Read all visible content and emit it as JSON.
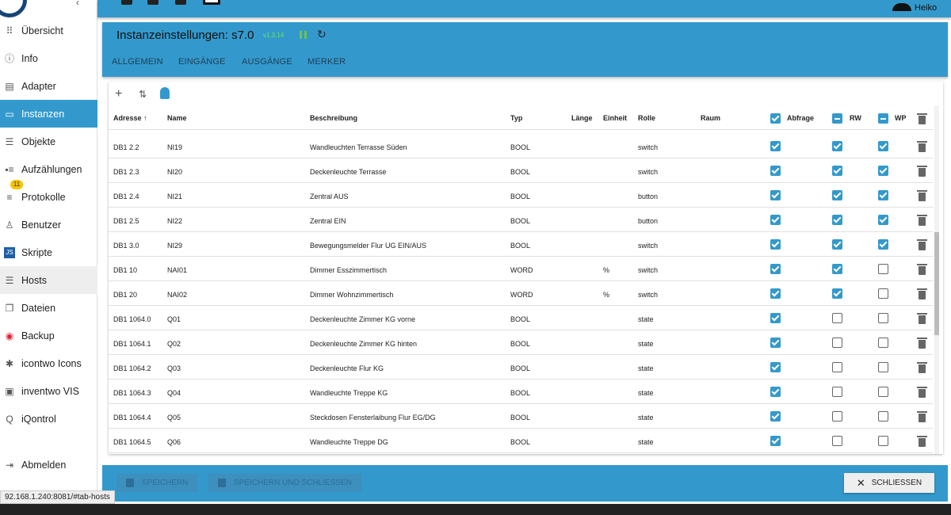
{
  "sidebar": {
    "items": [
      {
        "label": "Übersicht",
        "icon": "grid-icon"
      },
      {
        "label": "Info",
        "icon": "info-icon"
      },
      {
        "label": "Adapter",
        "icon": "store-icon"
      },
      {
        "label": "Instanzen",
        "icon": "instances-icon",
        "active": true
      },
      {
        "label": "Objekte",
        "icon": "list-icon"
      },
      {
        "label": "Aufzählungen",
        "icon": "enum-icon"
      },
      {
        "label": "Protokolle",
        "icon": "log-icon",
        "badge": "11"
      },
      {
        "label": "Benutzer",
        "icon": "user-icon"
      },
      {
        "label": "Skripte",
        "icon": "js-icon"
      },
      {
        "label": "Hosts",
        "icon": "hosts-icon",
        "hover": true
      },
      {
        "label": "Dateien",
        "icon": "files-icon"
      },
      {
        "label": "Backup",
        "icon": "backup-icon"
      },
      {
        "label": "icontwo Icons",
        "icon": "icons-icon"
      },
      {
        "label": "inventwo VIS",
        "icon": "vis-icon"
      },
      {
        "label": "iQontrol",
        "icon": "iqontrol-icon"
      }
    ],
    "logout": "Abmelden"
  },
  "topbar": {
    "user": "Heiko"
  },
  "dialog": {
    "title": "Instanzeinstellungen: s7.0",
    "version": "v1.3.14",
    "tabs": [
      "ALLGEMEIN",
      "EINGÄNGE",
      "AUSGÄNGE",
      "MERKER"
    ]
  },
  "table": {
    "headers": {
      "address": "Adresse",
      "name": "Name",
      "desc": "Beschreibung",
      "type": "Typ",
      "length": "Länge",
      "unit": "Einheit",
      "role": "Rolle",
      "room": "Raum",
      "poll": "Abfrage",
      "rw": "RW",
      "wp": "WP"
    },
    "rows": [
      {
        "address": "DB1 2.2",
        "name": "NI19",
        "desc": "Wandleuchten Terrasse Süden",
        "type": "BOOL",
        "length": "",
        "unit": "",
        "role": "switch",
        "room": "",
        "poll": true,
        "rw": true,
        "wp": true
      },
      {
        "address": "DB1 2.3",
        "name": "NI20",
        "desc": "Deckenleuchte Terrasse",
        "type": "BOOL",
        "length": "",
        "unit": "",
        "role": "switch",
        "room": "",
        "poll": true,
        "rw": true,
        "wp": true
      },
      {
        "address": "DB1 2.4",
        "name": "NI21",
        "desc": "Zentral AUS",
        "type": "BOOL",
        "length": "",
        "unit": "",
        "role": "button",
        "room": "",
        "poll": true,
        "rw": true,
        "wp": true
      },
      {
        "address": "DB1 2.5",
        "name": "NI22",
        "desc": "Zentral EIN",
        "type": "BOOL",
        "length": "",
        "unit": "",
        "role": "button",
        "room": "",
        "poll": true,
        "rw": true,
        "wp": true
      },
      {
        "address": "DB1 3.0",
        "name": "NI29",
        "desc": "Bewegungsmelder Flur UG EIN/AUS",
        "type": "BOOL",
        "length": "",
        "unit": "",
        "role": "switch",
        "room": "",
        "poll": true,
        "rw": true,
        "wp": true
      },
      {
        "address": "DB1 10",
        "name": "NAI01",
        "desc": "Dimmer Esszimmertisch",
        "type": "WORD",
        "length": "",
        "unit": "%",
        "role": "switch",
        "room": "",
        "poll": true,
        "rw": true,
        "wp": false
      },
      {
        "address": "DB1 20",
        "name": "NAI02",
        "desc": "Dimmer Wohnzimmertisch",
        "type": "WORD",
        "length": "",
        "unit": "%",
        "role": "switch",
        "room": "",
        "poll": true,
        "rw": true,
        "wp": false
      },
      {
        "address": "DB1 1064.0",
        "name": "Q01",
        "desc": "Deckenleuchte Zimmer KG vorne",
        "type": "BOOL",
        "length": "",
        "unit": "",
        "role": "state",
        "room": "",
        "poll": true,
        "rw": false,
        "wp": false
      },
      {
        "address": "DB1 1064.1",
        "name": "Q02",
        "desc": "Deckenleuchte Zimmer KG hinten",
        "type": "BOOL",
        "length": "",
        "unit": "",
        "role": "state",
        "room": "",
        "poll": true,
        "rw": false,
        "wp": false
      },
      {
        "address": "DB1 1064.2",
        "name": "Q03",
        "desc": "Deckenleuchte Flur KG",
        "type": "BOOL",
        "length": "",
        "unit": "",
        "role": "state",
        "room": "",
        "poll": true,
        "rw": false,
        "wp": false
      },
      {
        "address": "DB1 1064.3",
        "name": "Q04",
        "desc": "Wandleuchte Treppe KG",
        "type": "BOOL",
        "length": "",
        "unit": "",
        "role": "state",
        "room": "",
        "poll": true,
        "rw": false,
        "wp": false
      },
      {
        "address": "DB1 1064.4",
        "name": "Q05",
        "desc": "Steckdosen Fensterlaibung Flur EG/DG",
        "type": "BOOL",
        "length": "",
        "unit": "",
        "role": "state",
        "room": "",
        "poll": true,
        "rw": false,
        "wp": false
      },
      {
        "address": "DB1 1064.5",
        "name": "Q06",
        "desc": "Wandleuchte Treppe DG",
        "type": "BOOL",
        "length": "",
        "unit": "",
        "role": "state",
        "room": "",
        "poll": true,
        "rw": false,
        "wp": false
      }
    ]
  },
  "footer": {
    "save": "SPEICHERN",
    "save_close": "SPEICHERN UND SCHLIESSEN",
    "close": "SCHLIESSEN"
  },
  "status_url": "92.168.1.240:8081/#tab-hosts",
  "colors": {
    "primary": "#3399cc",
    "active_text": "#ffffff"
  }
}
